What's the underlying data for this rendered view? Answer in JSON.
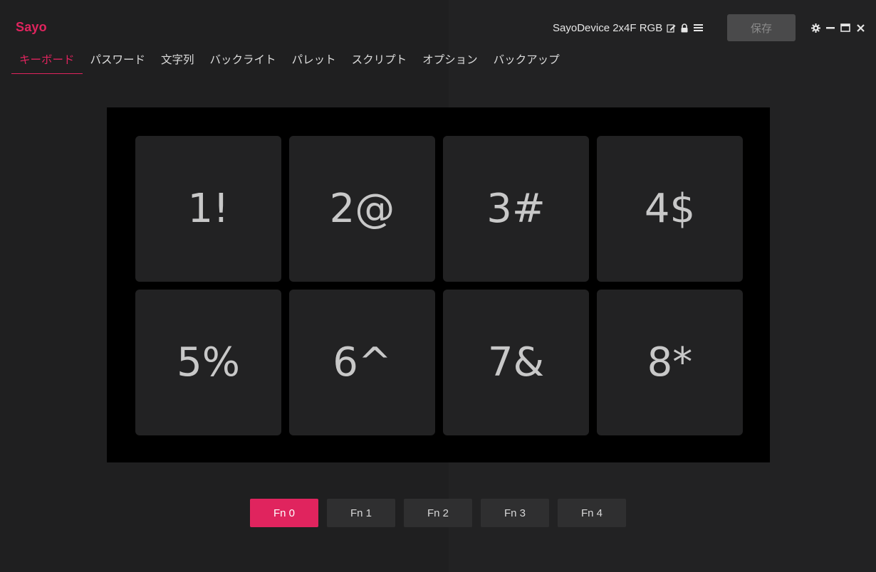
{
  "app": {
    "logo": "Sayo",
    "device_name": "SayoDevice 2x4F RGB",
    "save_label": "保存",
    "accent_color": "#e0245e"
  },
  "icons": {
    "edit": "edit-icon",
    "lock": "lock-icon",
    "menu": "menu-icon",
    "settings": "gear-icon",
    "minimize": "minimize-icon",
    "maximize": "maximize-icon",
    "close": "close-icon"
  },
  "tabs": [
    {
      "label": "キーボード",
      "active": true
    },
    {
      "label": "パスワード",
      "active": false
    },
    {
      "label": "文字列",
      "active": false
    },
    {
      "label": "バックライト",
      "active": false
    },
    {
      "label": "パレット",
      "active": false
    },
    {
      "label": "スクリプト",
      "active": false
    },
    {
      "label": "オプション",
      "active": false
    },
    {
      "label": "バックアップ",
      "active": false
    }
  ],
  "keys": [
    "1!",
    "2@",
    "3#",
    "4$",
    "5%",
    "6^",
    "7&",
    "8*"
  ],
  "fn_layers": [
    {
      "label": "Fn 0",
      "active": true
    },
    {
      "label": "Fn 1",
      "active": false
    },
    {
      "label": "Fn 2",
      "active": false
    },
    {
      "label": "Fn 3",
      "active": false
    },
    {
      "label": "Fn 4",
      "active": false
    }
  ]
}
